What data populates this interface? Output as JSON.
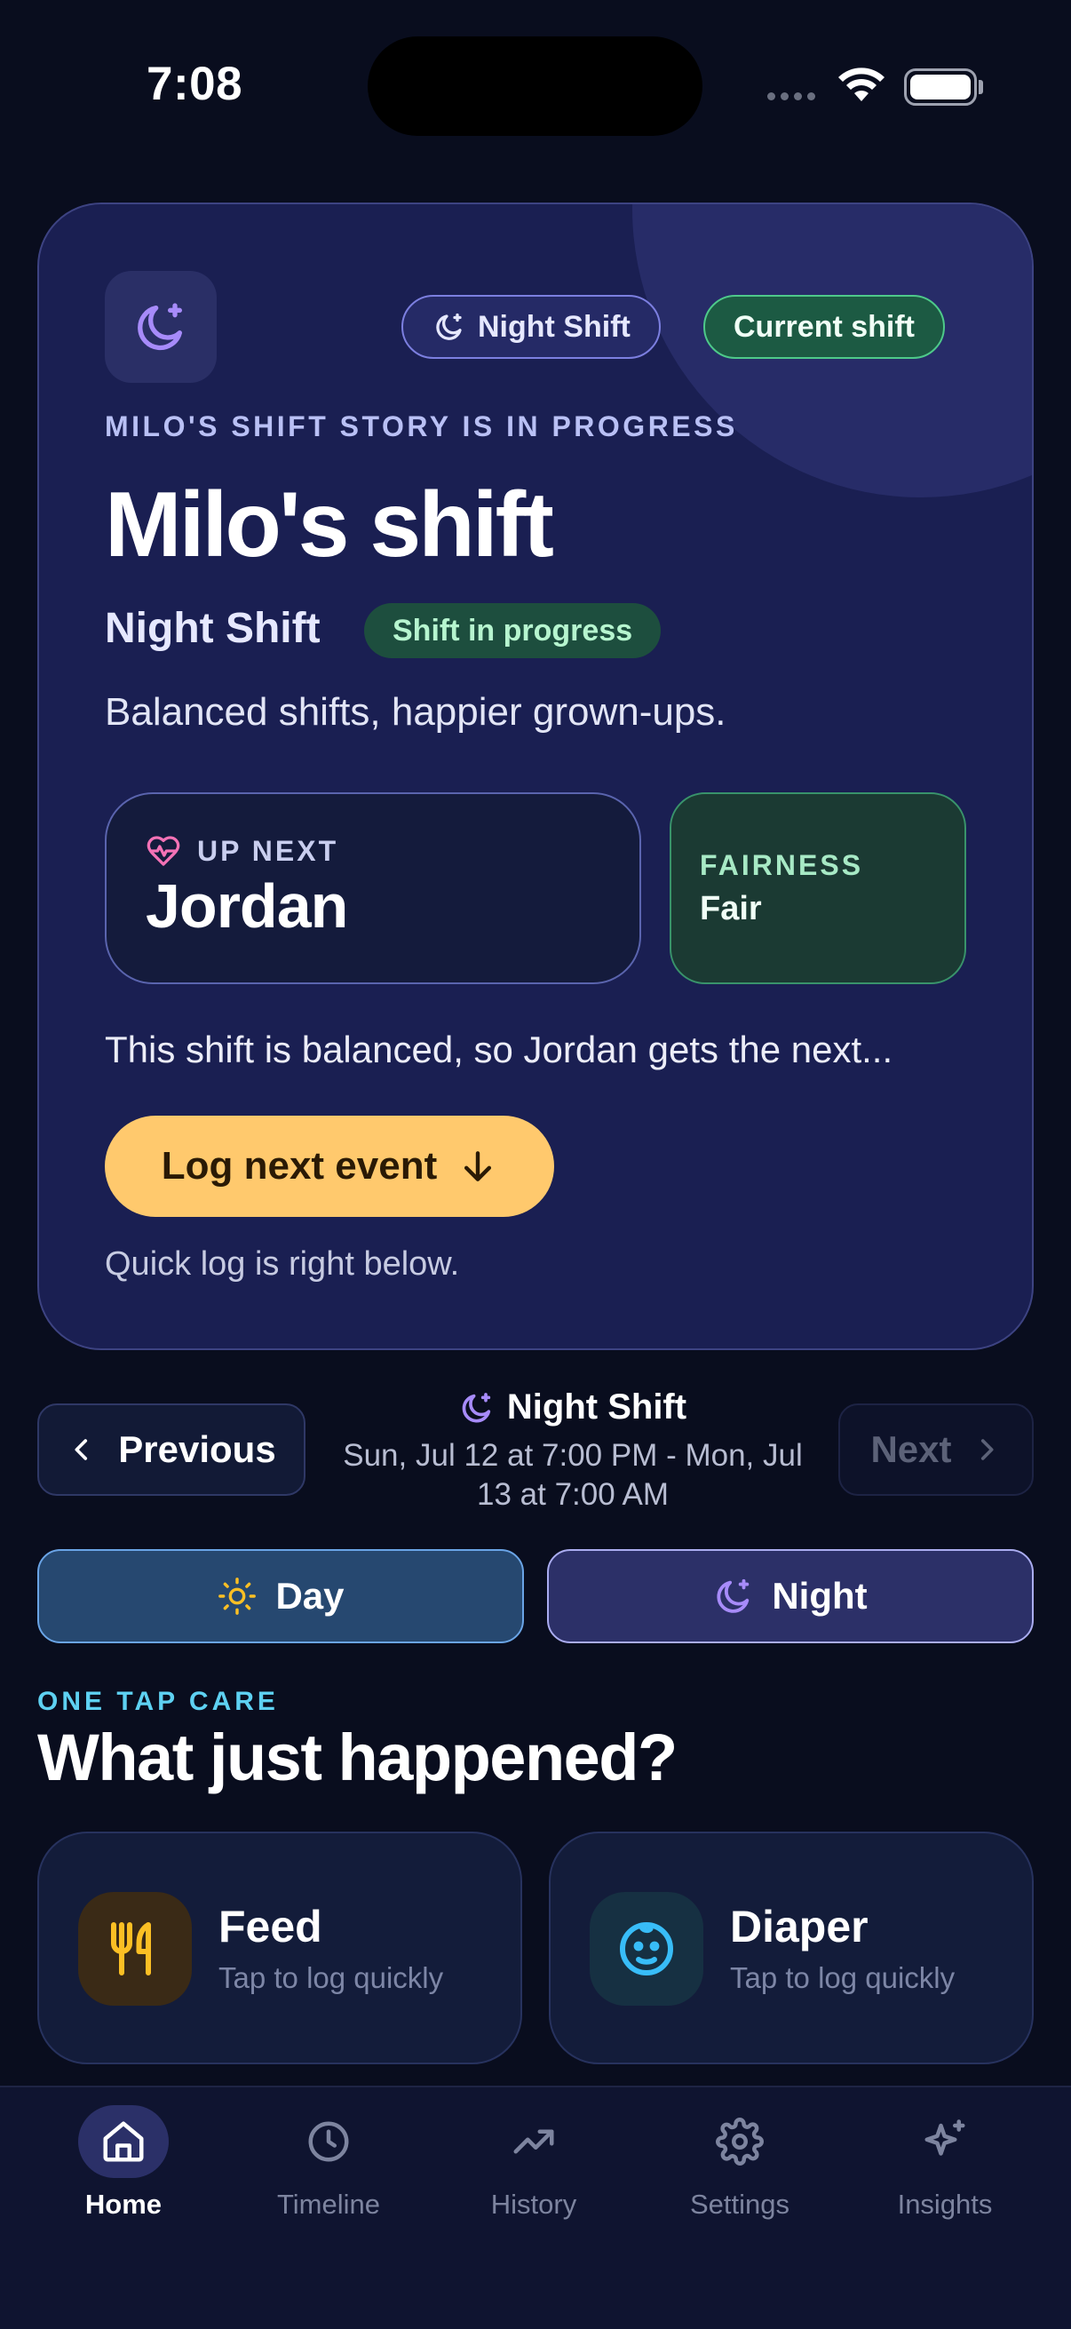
{
  "status_bar": {
    "time": "7:08"
  },
  "hero": {
    "chip_shift": "Night Shift",
    "chip_current": "Current shift",
    "eyebrow": "MILO'S SHIFT STORY IS IN PROGRESS",
    "title": "Milo's shift",
    "subtitle": "Night Shift",
    "status_pill": "Shift in progress",
    "tagline": "Balanced shifts, happier grown-ups.",
    "up_next": {
      "label": "UP NEXT",
      "name": "Jordan"
    },
    "fairness": {
      "label": "FAIRNESS",
      "value": "Fair"
    },
    "explanation": "This shift is balanced, so Jordan gets the next...",
    "log_button": "Log next event",
    "quick_log_hint": "Quick log is right below."
  },
  "shift_nav": {
    "previous_label": "Previous",
    "next_label": "Next",
    "current_title": "Night Shift",
    "current_range": "Sun, Jul 12 at 7:00 PM - Mon, Jul 13 at 7:00 AM"
  },
  "mode_toggle": {
    "day_label": "Day",
    "night_label": "Night"
  },
  "care": {
    "eyebrow": "ONE TAP CARE",
    "title": "What just happened?",
    "items": [
      {
        "name": "Feed",
        "hint": "Tap to log quickly",
        "icon": "fork-knife-icon"
      },
      {
        "name": "Diaper",
        "hint": "Tap to log quickly",
        "icon": "baby-face-icon"
      }
    ]
  },
  "tabs": [
    {
      "label": "Home",
      "icon": "home-icon",
      "active": true
    },
    {
      "label": "Timeline",
      "icon": "clock-icon",
      "active": false
    },
    {
      "label": "History",
      "icon": "trend-icon",
      "active": false
    },
    {
      "label": "Settings",
      "icon": "gear-icon",
      "active": false
    },
    {
      "label": "Insights",
      "icon": "sparkle-icon",
      "active": false
    }
  ],
  "colors": {
    "background": "#090d1e",
    "hero_card": "#1a1f52",
    "accent_yellow": "#ffc96d",
    "accent_green": "#4ec98a",
    "accent_cyan": "#5ed1f2",
    "accent_purple": "#a78bfa"
  }
}
